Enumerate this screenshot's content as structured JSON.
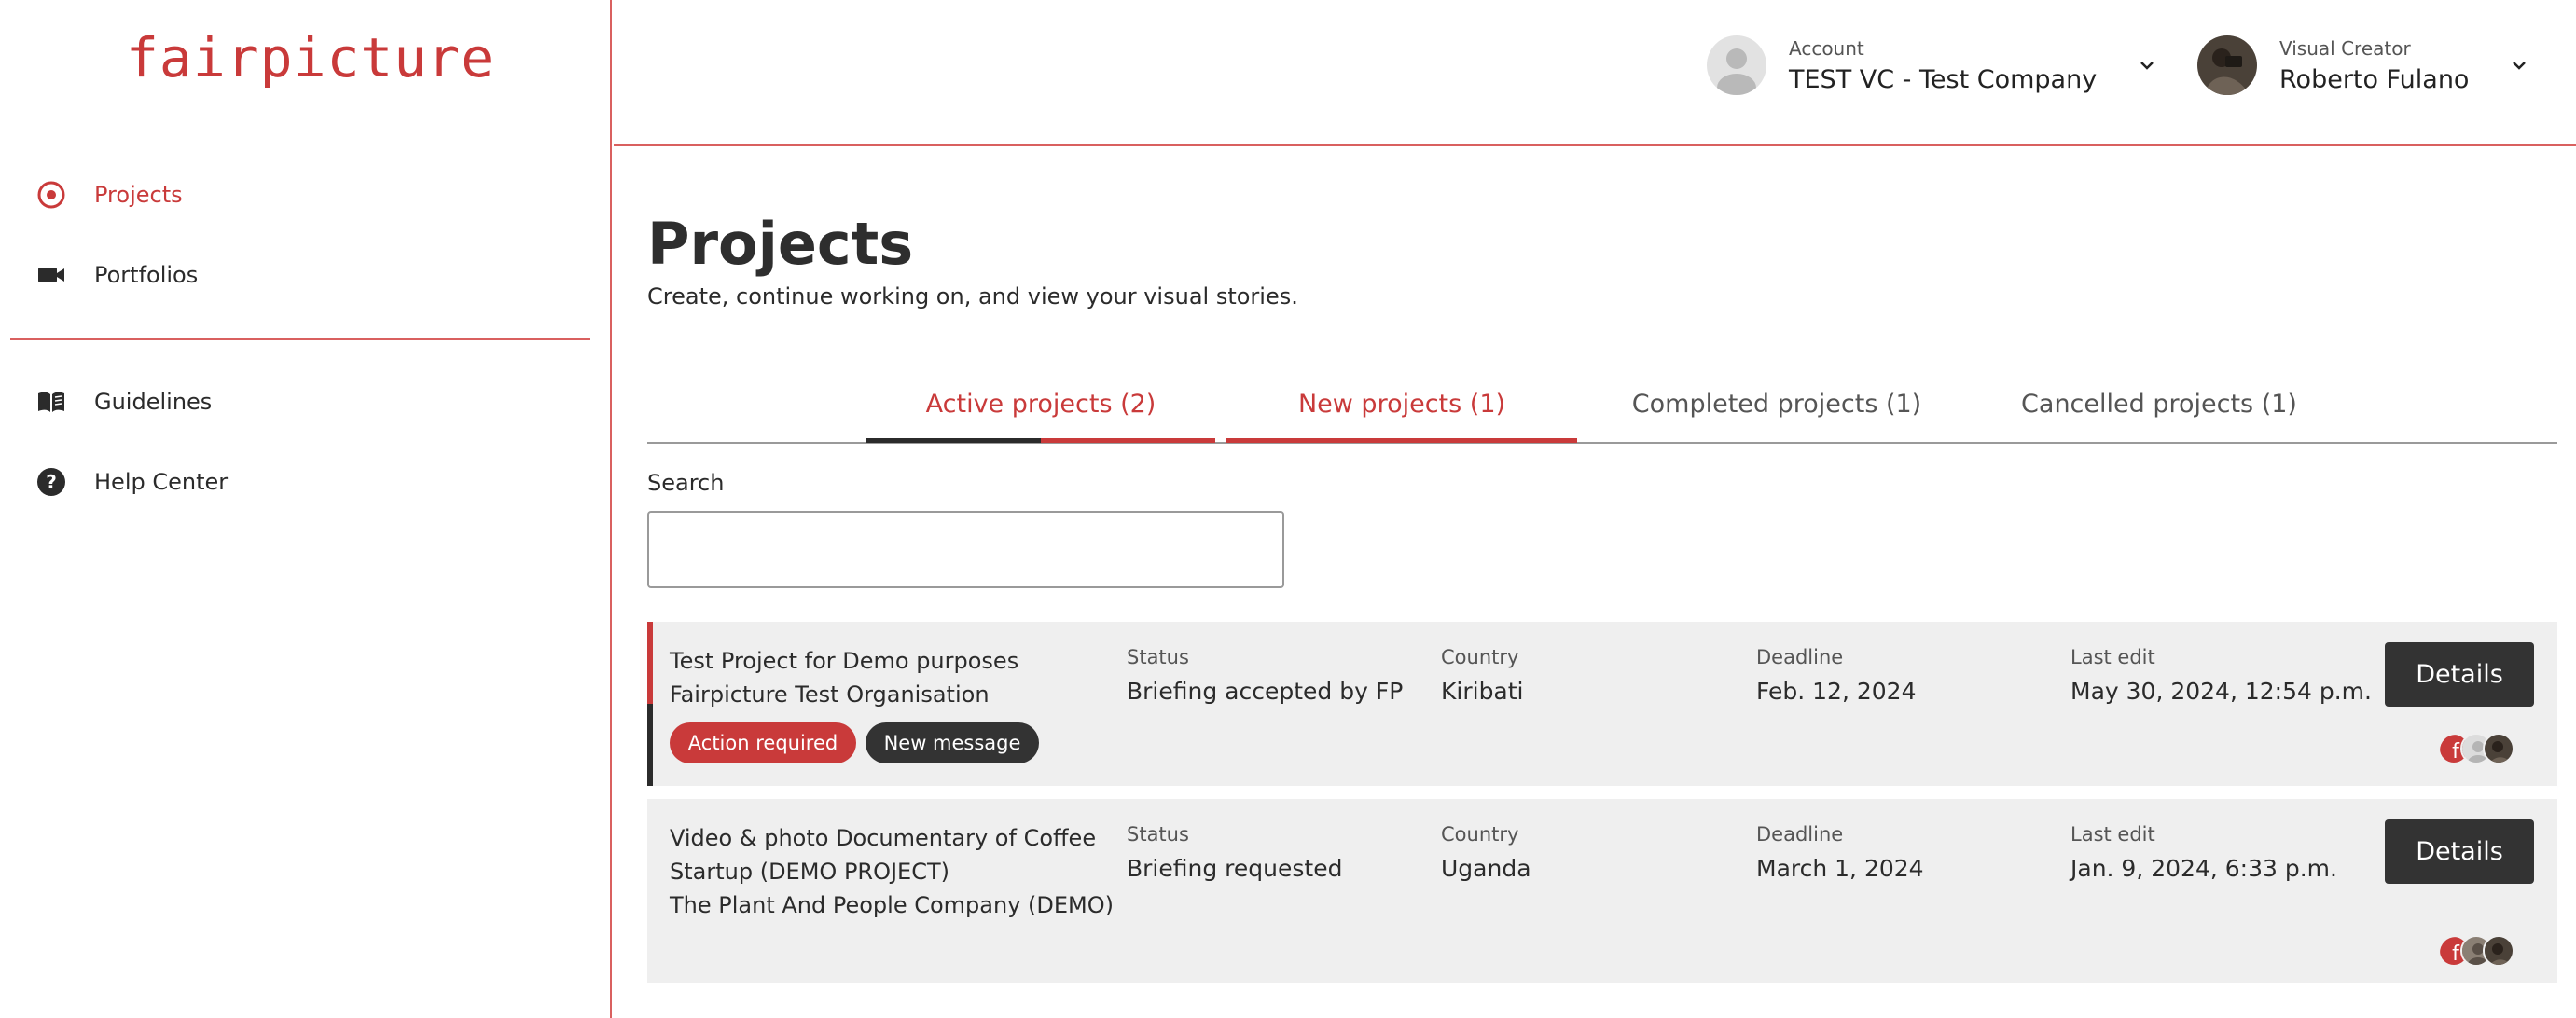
{
  "brand": {
    "logo": "fairpicture"
  },
  "sidebar": {
    "items": [
      {
        "label": "Projects",
        "icon": "target-circle-icon"
      },
      {
        "label": "Portfolios",
        "icon": "video-camera-icon"
      },
      {
        "label": "Guidelines",
        "icon": "book-icon"
      },
      {
        "label": "Help Center",
        "icon": "question-circle-icon"
      }
    ]
  },
  "header": {
    "account": {
      "caption": "Account",
      "name": "TEST VC - Test Company"
    },
    "creator": {
      "caption": "Visual Creator",
      "name": "Roberto Fulano"
    }
  },
  "page": {
    "title": "Projects",
    "subtitle": "Create, continue working on, and view your visual stories."
  },
  "tabs": [
    {
      "label": "Active projects (2)"
    },
    {
      "label": "New projects (1)"
    },
    {
      "label": "Completed projects (1)"
    },
    {
      "label": "Cancelled projects (1)"
    }
  ],
  "search": {
    "label": "Search",
    "value": ""
  },
  "columns": {
    "status": "Status",
    "country": "Country",
    "deadline": "Deadline",
    "last_edit": "Last edit"
  },
  "projects": [
    {
      "title_lines": [
        "Test Project for Demo purposes",
        "Fairpicture Test Organisation"
      ],
      "status": "Briefing accepted by FP",
      "country": "Kiribati",
      "deadline": "Feb. 12, 2024",
      "last_edit": "May 30, 2024, 12:54 p.m.",
      "badges": [
        "Action required",
        "New message"
      ],
      "details_label": "Details"
    },
    {
      "title_lines": [
        "Video & photo Documentary of Coffee",
        "Startup (DEMO PROJECT)",
        "The Plant And People Company (DEMO)"
      ],
      "status": "Briefing requested",
      "country": "Uganda",
      "deadline": "March 1, 2024",
      "last_edit": "Jan. 9, 2024, 6:33 p.m.",
      "badges": [],
      "details_label": "Details"
    }
  ],
  "colors": {
    "brand_red": "#c93a3a",
    "dark": "#333333",
    "card_bg": "#efefef",
    "divider_red": "#d9605f"
  }
}
